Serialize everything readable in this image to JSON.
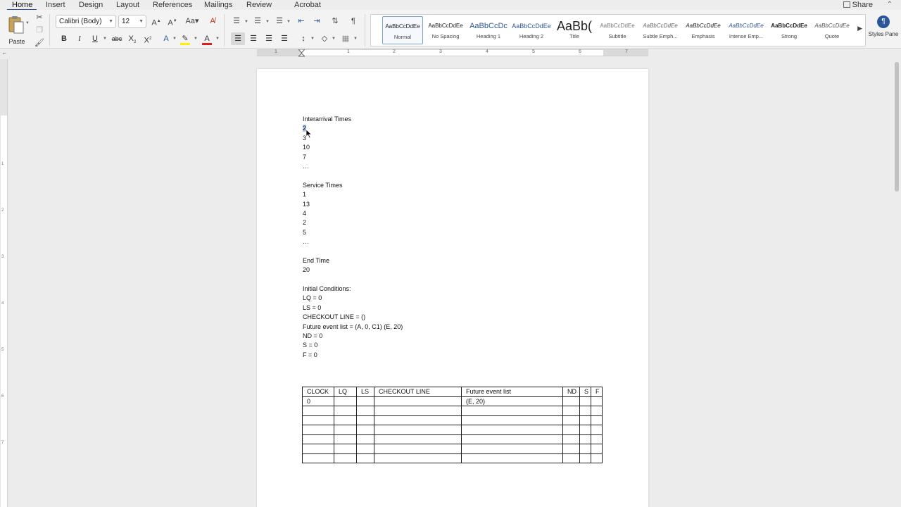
{
  "ribbon": {
    "tabs": [
      "Home",
      "Insert",
      "Design",
      "Layout",
      "References",
      "Mailings",
      "Review",
      "Acrobat"
    ],
    "active_tab": "Home",
    "share_label": "Share",
    "paste_label": "Paste",
    "font_name": "Calibri (Body)",
    "font_size": "12",
    "styles": [
      {
        "sample": "AaBbCcDdEe",
        "name": "Normal"
      },
      {
        "sample": "AaBbCcDdEe",
        "name": "No Spacing"
      },
      {
        "sample": "AaBbCcDc",
        "name": "Heading 1"
      },
      {
        "sample": "AaBbCcDdEe",
        "name": "Heading 2"
      },
      {
        "sample": "AaBb(",
        "name": "Title"
      },
      {
        "sample": "AaBbCcDdEe",
        "name": "Subtitle"
      },
      {
        "sample": "AaBbCcDdEe",
        "name": "Subtle Emph..."
      },
      {
        "sample": "AaBbCcDdEe",
        "name": "Emphasis"
      },
      {
        "sample": "AaBbCcDdEe",
        "name": "Intense Emp..."
      },
      {
        "sample": "AaBbCcDdEe",
        "name": "Strong"
      },
      {
        "sample": "AaBbCcDdEe",
        "name": "Quote"
      }
    ],
    "selected_style": "Normal",
    "styles_pane_label": "Styles Pane",
    "accent_color": "#2b579a",
    "font_color": "#e01b1b",
    "highlight_color": "#ffee00"
  },
  "ruler": {
    "numbers": [
      "1",
      "1",
      "2",
      "3",
      "4",
      "5",
      "6",
      "7"
    ],
    "vertical_numbers": [
      "1",
      "2",
      "3",
      "4",
      "5",
      "6",
      "7"
    ]
  },
  "document": {
    "interarrival_heading": "Interarrival Times",
    "interarrival_values": [
      "2",
      "3",
      "10",
      "7",
      "…"
    ],
    "service_heading": "Service Times",
    "service_values": [
      "1",
      "13",
      "4",
      "2",
      "5",
      "…"
    ],
    "end_time_heading": "End Time",
    "end_time_value": "20",
    "initial_heading": "Initial Conditions:",
    "initial_conditions": [
      "LQ = 0",
      "LS = 0",
      "CHECKOUT LINE = ()",
      "Future event list = (A, 0, C1) (E, 20)",
      "ND = 0",
      "S = 0",
      "F = 0"
    ],
    "table": {
      "headers": [
        "CLOCK",
        "LQ",
        "LS",
        "CHECKOUT LINE",
        "Future event list",
        "ND",
        "S",
        "F"
      ],
      "rows": [
        [
          "0",
          "",
          "",
          "",
          "(E, 20)",
          "",
          "",
          ""
        ],
        [
          "",
          "",
          "",
          "",
          "",
          "",
          "",
          ""
        ],
        [
          "",
          "",
          "",
          "",
          "",
          "",
          "",
          ""
        ],
        [
          "",
          "",
          "",
          "",
          "",
          "",
          "",
          ""
        ],
        [
          "",
          "",
          "",
          "",
          "",
          "",
          "",
          ""
        ],
        [
          "",
          "",
          "",
          "",
          "",
          "",
          "",
          ""
        ],
        [
          "",
          "",
          "",
          "",
          "",
          "",
          "",
          ""
        ]
      ]
    }
  }
}
